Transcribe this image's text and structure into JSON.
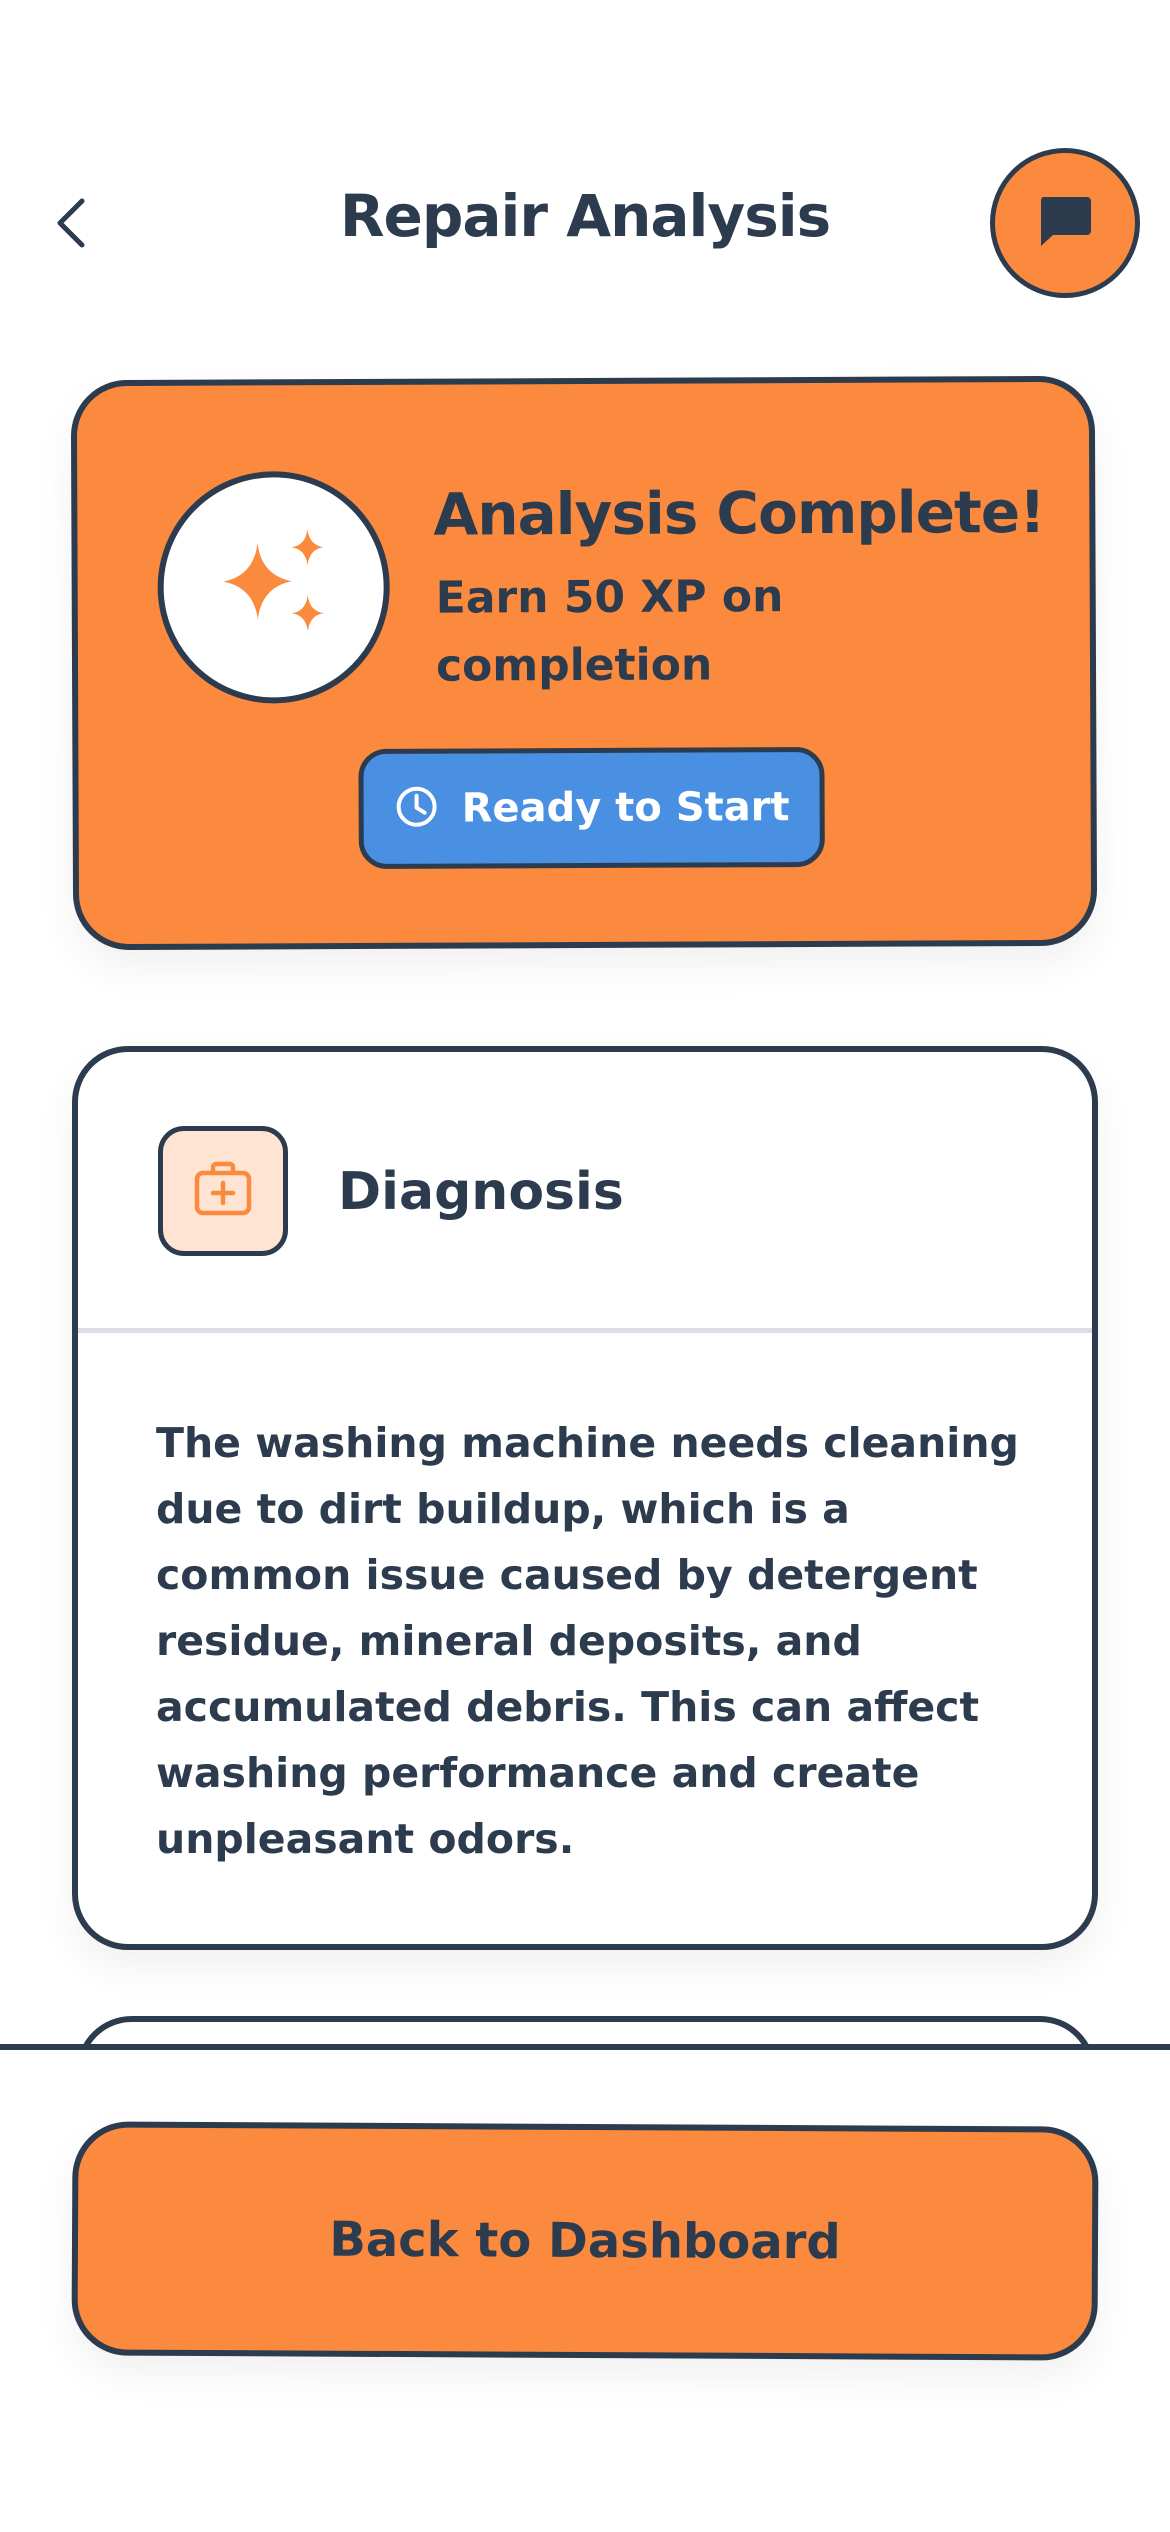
{
  "header": {
    "title": "Repair Analysis",
    "back_icon": "chevron-left-icon",
    "chat_icon": "chat-bubble-icon"
  },
  "status_card": {
    "title": "Analysis Complete!",
    "subtitle": "Earn 50 XP on completion",
    "icon": "sparkles-icon",
    "button_label": "Ready to Start",
    "button_icon": "clock-icon"
  },
  "diagnosis": {
    "title": "Diagnosis",
    "icon": "first-aid-kit-icon",
    "text": "The washing machine needs cleaning due to dirt buildup, which is a common issue caused by detergent residue, mineral deposits, and accumulated debris. This can affect washing performance and create unpleasant odors."
  },
  "footer": {
    "button_label": "Back to Dashboard"
  },
  "colors": {
    "accent_orange": "#fb8a3e",
    "button_blue": "#4a90e2",
    "ink": "#2c3b4d",
    "icon_bg_peach": "#ffe4d4"
  }
}
